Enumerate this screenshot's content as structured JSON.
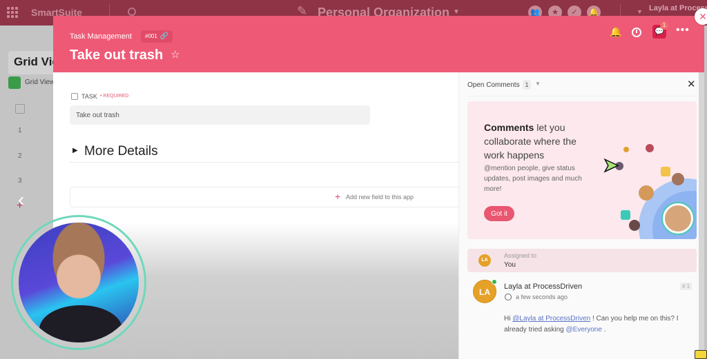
{
  "topbar": {
    "brand": "SmartSuite",
    "workspace_title": "Personal Organization",
    "user_name": "Layla at ProcessDriven",
    "icons": [
      "apps-grid-icon",
      "search-icon",
      "team-icon",
      "star-icon",
      "check-icon",
      "bell-icon"
    ]
  },
  "background": {
    "view_title": "Grid View",
    "view_label": "Grid View",
    "rows": [
      "1",
      "2",
      "3"
    ]
  },
  "record": {
    "app_name": "Task Management",
    "record_id": "#001",
    "title": "Take out trash",
    "header_icons": [
      "bell-icon",
      "clock-icon",
      "comments-icon",
      "more-icon"
    ],
    "comments_badge": "1",
    "task_field": {
      "label": "TASK",
      "required": "• REQUIRED",
      "value": "Take out trash"
    },
    "more_details": "More Details",
    "add_field": "Add new field to this app"
  },
  "comments_panel": {
    "title": "Open Comments",
    "count": "1",
    "promo": {
      "headline_bold": "Comments",
      "headline_rest": " let you collaborate where the work happens",
      "subtext": "@mention people, give status updates, post images and much more!",
      "button": "Got it"
    },
    "assigned": {
      "label": "Assigned to",
      "value": "You",
      "initials": "LA"
    },
    "comment": {
      "initials": "LA",
      "author": "Layla at ProcessDriven",
      "number": "# 1",
      "time": "a few seconds ago",
      "text_prefix": "Hi ",
      "mention_user": "@Layla at ProcessDriven",
      "text_mid": " ! Can you help me on this? I already tried asking ",
      "mention_all": "@Everyone",
      "text_suffix": " ."
    }
  }
}
